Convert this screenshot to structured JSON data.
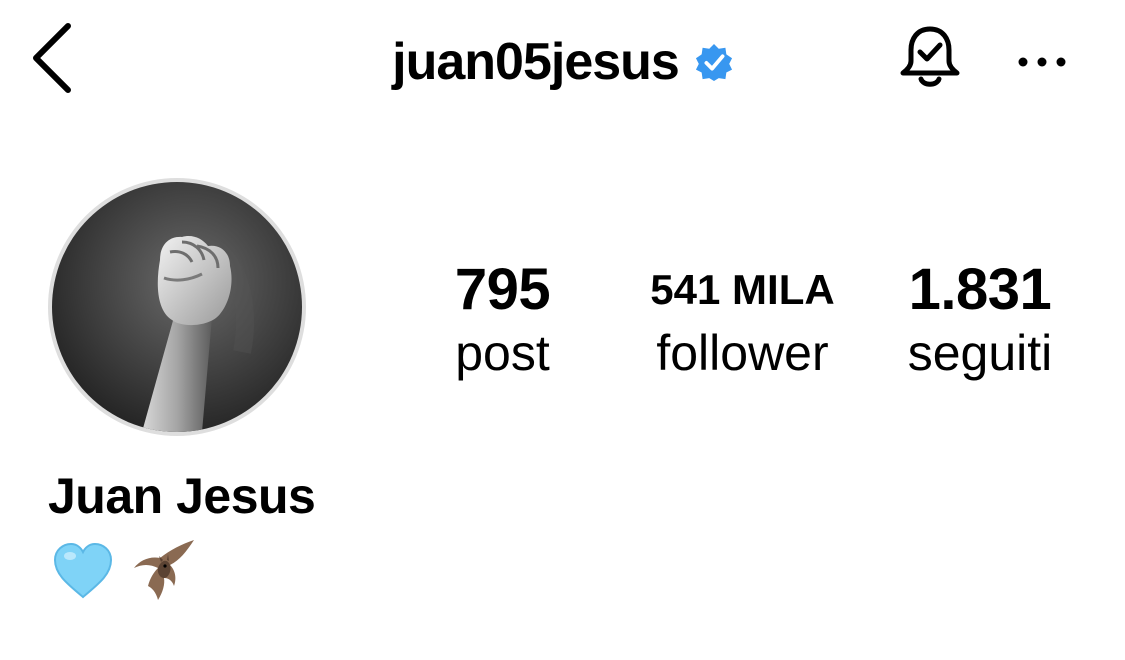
{
  "header": {
    "username": "juan05jesus",
    "verified_icon": "verified-badge-icon",
    "back_icon": "chevron-left-icon",
    "bell_icon": "notification-bell-icon",
    "more_icon": "more-horizontal-icon"
  },
  "profile": {
    "avatar_icon": "raised-fist-photo",
    "full_name": "Juan Jesus",
    "bio_icons": [
      "light-blue-heart-icon",
      "bat-icon"
    ]
  },
  "stats": {
    "posts": {
      "value": "795",
      "label": "post"
    },
    "followers": {
      "value": "541 MILA",
      "label": "follower"
    },
    "following": {
      "value": "1.831",
      "label": "seguiti"
    }
  },
  "colors": {
    "verified_blue": "#3897f0",
    "heart_blue": "#7fd3f7",
    "text": "#000000"
  }
}
